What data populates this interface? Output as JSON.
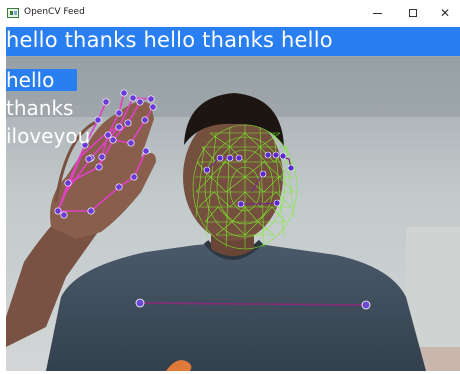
{
  "window": {
    "title": "OpenCV Feed",
    "controls": {
      "minimize": "minimize-icon",
      "maximize": "maximize-icon",
      "close": "close-icon"
    },
    "close_glyph": "✕"
  },
  "overlay": {
    "sentence": "hello thanks hello thanks hello",
    "actions": [
      {
        "label": "hello",
        "probability": 0.62
      },
      {
        "label": "thanks",
        "probability": 0.0
      },
      {
        "label": "iloveyou",
        "probability": 0.0
      }
    ],
    "colors": {
      "bar": "#2a7ff0",
      "face_mesh": "#7cf02a",
      "hand_lines": "#e040c8",
      "hand_points": "#5a2ad0",
      "pose_line": "#8a2a7a"
    }
  }
}
